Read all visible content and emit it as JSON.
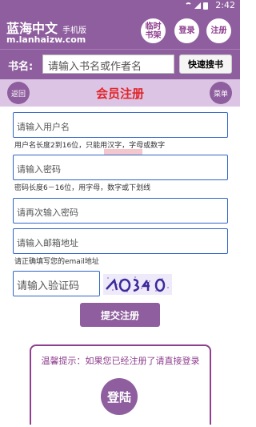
{
  "status_bar": {
    "time": "2:42"
  },
  "header": {
    "site_name": "蓝海中文",
    "site_sub": "手机版",
    "domain": "m.lanhaizw.com",
    "temp_bookshelf_label": "临时\n书架",
    "login_label": "登录",
    "register_label": "注册"
  },
  "search": {
    "label": "书名:",
    "placeholder": "请输入书名或作者名",
    "button_label": "快速搜书"
  },
  "titlebar": {
    "back_label": "返回",
    "title": "会员注册",
    "menu_label": "菜单"
  },
  "form": {
    "username_placeholder": "请输入用户名",
    "username_hint": "用户名长度2到16位，只能用汉字，字母或数字",
    "password_placeholder": "请输入密码",
    "password_hint": "密码长度6－16位，用字母，数字或下划线",
    "password_confirm_placeholder": "请再次输入密码",
    "email_placeholder": "请输入邮箱地址",
    "email_hint": "请正确填写您的email地址",
    "captcha_placeholder": "请输入验证码",
    "submit_label": "提交注册"
  },
  "login_panel": {
    "tip": "温馨提示：如果您已经注册了请直接登录",
    "login_label": "登陆"
  },
  "colors": {
    "brand_purple": "#8e5e9e",
    "title_red": "#e2252a",
    "input_border": "#2f66c9"
  }
}
